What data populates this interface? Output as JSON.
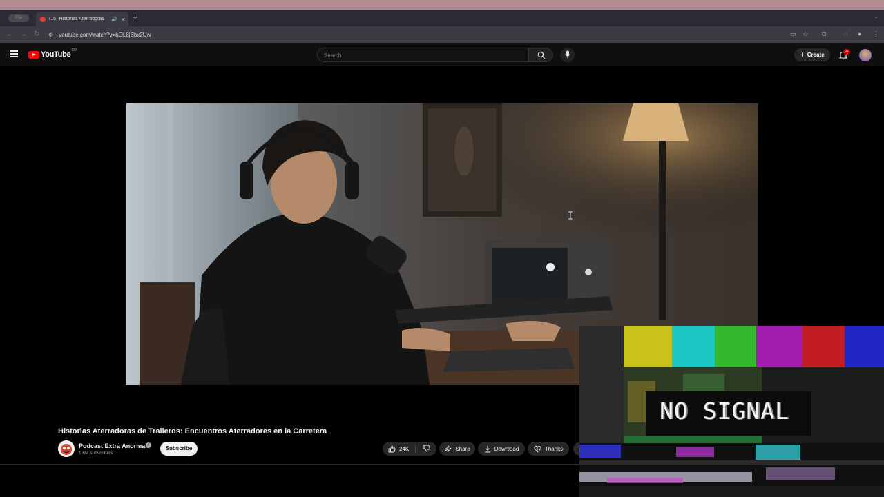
{
  "browser": {
    "tab_pill": "File",
    "tab_title": "(15) Historias Aterradoras",
    "url": "youtube.com/watch?v=hOL8jBbx2Uw"
  },
  "youtube": {
    "logo_text": "YouTube",
    "logo_region": "CO",
    "search_placeholder": "Search",
    "create_label": "Create",
    "notif_badge": "9+"
  },
  "video": {
    "title": "Historias Aterradoras de Traileros: Encuentros Aterradores en la Carretera",
    "channel_name": "Podcast Extra Anormal",
    "subscribers": "1.6M subscribers",
    "subscribe_label": "Subscribe",
    "likes": "24K",
    "share_label": "Share",
    "download_label": "Download",
    "thanks_label": "Thanks"
  },
  "overlay": {
    "no_signal_text": "NO SIGNAL"
  },
  "colors": {
    "accent_red": "#ff0000",
    "background": "#0f0f0f",
    "pill": "#272727"
  }
}
